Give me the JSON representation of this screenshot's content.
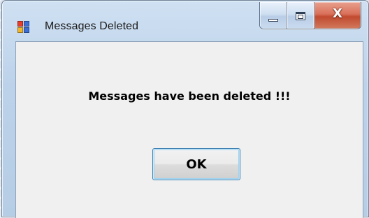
{
  "window": {
    "title": "Messages Deleted",
    "icon": "windows-form-icon",
    "caption_buttons": {
      "minimize_icon": "minimize-icon",
      "maximize_icon": "maximize-icon",
      "close_label": "X"
    }
  },
  "dialog": {
    "message": "Messages have been deleted !!!",
    "ok_label": "OK"
  },
  "colors": {
    "client_bg": "#f0f0f0",
    "close_button": "#c04a2f",
    "button_focus_border": "#3c7fb1"
  }
}
